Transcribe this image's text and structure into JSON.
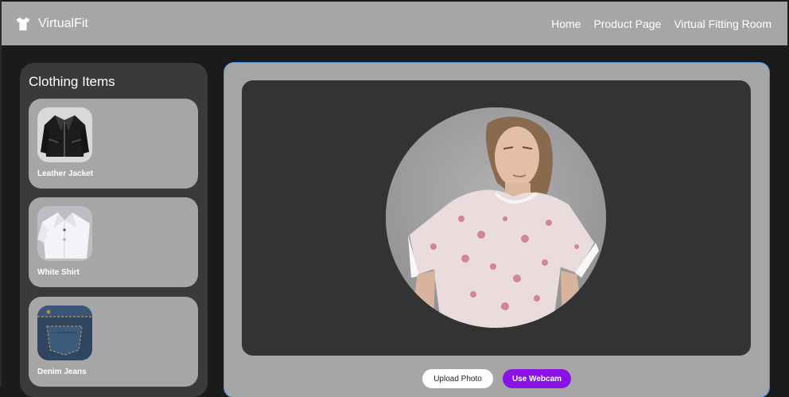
{
  "app": {
    "name": "VirtualFit",
    "logo_icon": "tshirt-icon"
  },
  "nav": {
    "links": [
      {
        "label": "Home"
      },
      {
        "label": "Product Page"
      },
      {
        "label": "Virtual Fitting Room"
      }
    ]
  },
  "sidebar": {
    "title": "Clothing Items",
    "items": [
      {
        "label": "Leather Jacket",
        "icon": "leather-jacket-image"
      },
      {
        "label": "White Shirt",
        "icon": "white-shirt-image"
      },
      {
        "label": "Denim Jeans",
        "icon": "denim-jeans-image"
      }
    ]
  },
  "fitting_room": {
    "preview_image": "model-portrait-floral-top",
    "upload_label": "Upload Photo",
    "webcam_label": "Use Webcam"
  },
  "colors": {
    "accent": "#8a12e6",
    "panel": "#a6a6a6",
    "background": "#1b1b1b"
  }
}
